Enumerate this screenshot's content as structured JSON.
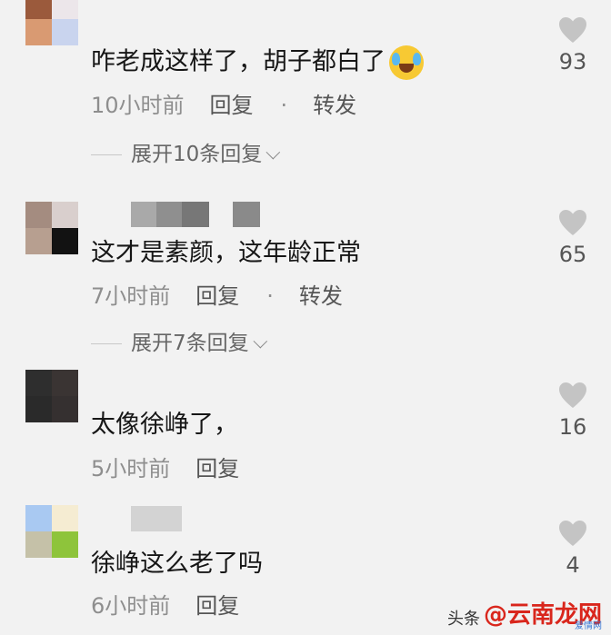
{
  "comments": [
    {
      "text": "咋老成这样了，胡子都白了",
      "emoji": "crying-laughing-emoji",
      "time": "10小时前",
      "reply": "回复",
      "dot": "·",
      "forward": "转发",
      "expand": "展开10条回复",
      "likes": "93",
      "avatar_colors": [
        "#9b5a3c",
        "#ece6ea",
        "#d99a72",
        "#c9d4ee"
      ]
    },
    {
      "text": "这才是素颜，这年龄正常",
      "time": "7小时前",
      "reply": "回复",
      "dot": "·",
      "forward": "转发",
      "expand": "展开7条回复",
      "likes": "65",
      "avatar_colors": [
        "#a48c80",
        "#d9cfcd",
        "#b79f90",
        "#121212"
      ]
    },
    {
      "text": "太像徐峥了，",
      "time": "5小时前",
      "reply": "回复",
      "likes": "16",
      "avatar_colors": [
        "#2e2e2e",
        "#3a3433",
        "#2a2a2a",
        "#353030"
      ]
    },
    {
      "text": "徐峥这么老了吗",
      "time": "6小时前",
      "reply": "回复",
      "likes": "4",
      "avatar_colors": [
        "#a9c9f2",
        "#f5ecd2",
        "#c5c1a8",
        "#8ec43b"
      ]
    }
  ],
  "watermark": {
    "source": "头条",
    "brand": "@云南龙网",
    "small": "爱情网"
  },
  "colors": {
    "background": "#f2f2f2",
    "heart": "#c4c4c4",
    "brand": "#d9261c"
  },
  "icons": {
    "like": "heart-icon",
    "expand": "chevron-down-icon"
  }
}
